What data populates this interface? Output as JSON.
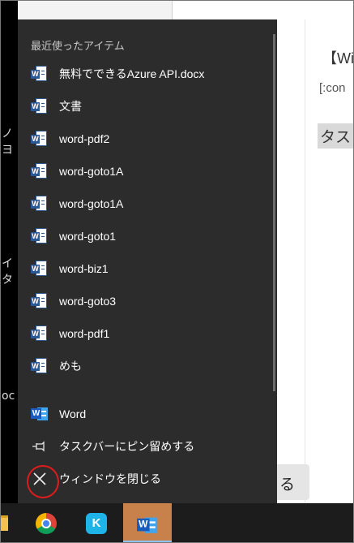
{
  "background": {
    "left_snippets": [
      "ノヨ",
      "イタ",
      "oc"
    ],
    "doc_texts": [
      "【Wi",
      "[:con",
      "タス"
    ],
    "doc_button_label": "る"
  },
  "jumplist": {
    "section_header": "最近使ったアイテム",
    "recent_items": [
      "無料でできるAzure API.docx",
      "文書",
      "word-pdf2",
      "word-goto1A",
      "word-goto1A",
      "word-goto1",
      "word-biz1",
      "word-goto3",
      "word-pdf1",
      "めも"
    ],
    "app_item": "Word",
    "pin_item": "タスクバーにピン留めする",
    "close_item": "ウィンドウを閉じる"
  },
  "taskbar": {
    "icons": [
      "file-explorer-icon",
      "chrome-icon",
      "kindle-icon",
      "word-icon"
    ],
    "active": "word-icon"
  },
  "colors": {
    "jumplist_bg": "#2c2c2c",
    "word_blue": "#2b5797",
    "active_taskbar": "#c8814a",
    "annotation_red": "#e01b1b"
  }
}
